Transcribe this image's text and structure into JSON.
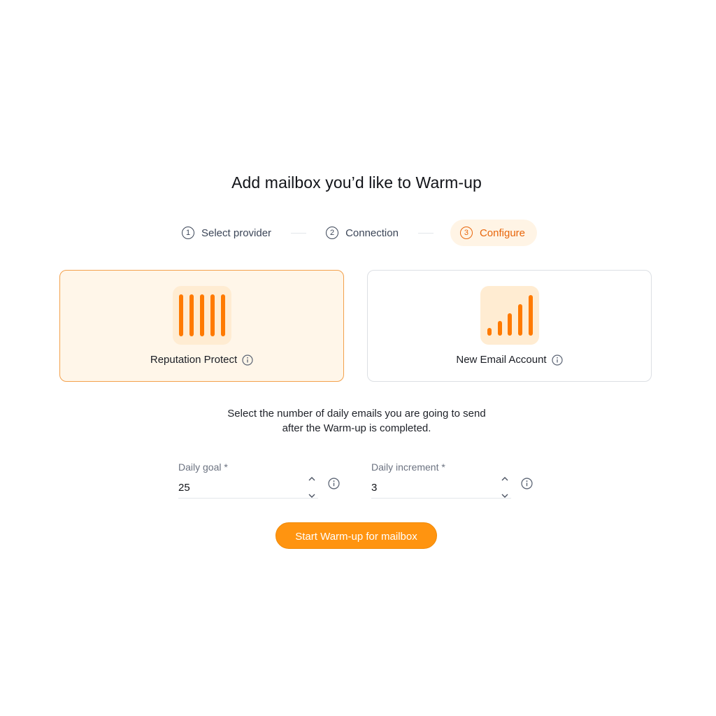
{
  "title": "Add mailbox you’d like to Warm-up",
  "stepper": {
    "steps": [
      {
        "number": "1",
        "label": "Select provider",
        "state": "done"
      },
      {
        "number": "2",
        "label": "Connection",
        "state": "done"
      },
      {
        "number": "3",
        "label": "Configure",
        "state": "active"
      }
    ]
  },
  "modes": [
    {
      "label": "Reputation Protect",
      "icon": "equal-bars-icon",
      "selected": true,
      "info_icon": "info-icon"
    },
    {
      "label": "New Email Account",
      "icon": "ascending-bars-icon",
      "selected": false,
      "info_icon": "info-icon"
    }
  ],
  "description": {
    "line1": "Select the number of daily emails you are going to send",
    "line2": "after the Warm-up is completed."
  },
  "fields": {
    "daily_goal": {
      "label": "Daily goal *",
      "value": "25"
    },
    "daily_increment": {
      "label": "Daily increment *",
      "value": "3"
    }
  },
  "cta": {
    "label": "Start Warm-up for mailbox"
  },
  "colors": {
    "accent": "#ff9410",
    "accent_text": "#e8650a",
    "bar": "#ff7a00",
    "icon_tile": "#ffecd2",
    "selected_card_bg": "#fff6e9",
    "selected_card_border": "#f3a04b"
  }
}
